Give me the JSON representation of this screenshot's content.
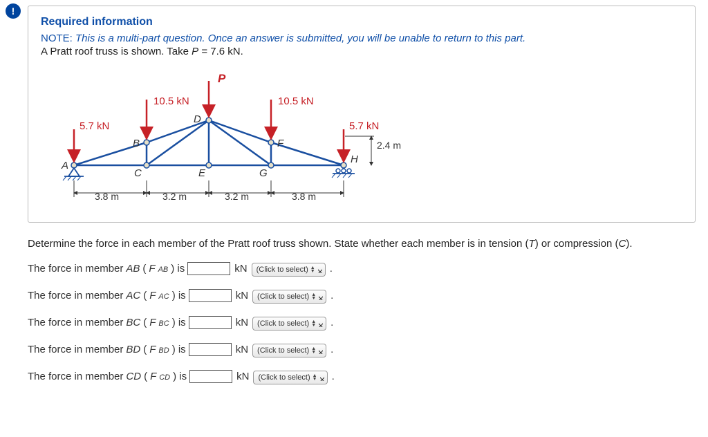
{
  "icon": "!",
  "header": "Required information",
  "note_prefix": "NOTE: ",
  "note_body": "This is a multi-part question. Once an answer is submitted, you will be unable to return to this part.",
  "given": "A Pratt roof truss is shown. Take ",
  "given_var": "P",
  "given_rest": " = 7.6 kN.",
  "diagram": {
    "P": "P",
    "load_top_left": "10.5 kN",
    "load_top_right": "10.5 kN",
    "load_left": "5.7 kN",
    "load_right": "5.7 kN",
    "A": "A",
    "B": "B",
    "C": "C",
    "D": "D",
    "E": "E",
    "F": "F",
    "G": "G",
    "H": "H",
    "h": "2.4 m",
    "d1": "3.8 m",
    "d2": "3.2 m",
    "d3": "3.2 m",
    "d4": "3.8 m"
  },
  "question": {
    "pre": "Determine the force in each member of the Pratt roof truss shown. State whether each member is in tension (",
    "t": "T",
    "mid": ") or compression (",
    "c": "C",
    "post": ")."
  },
  "rows": [
    {
      "pre": "The force in member ",
      "member": "AB",
      "fsym": "F",
      "sub": "AB",
      "after": ") is"
    },
    {
      "pre": "The force in member ",
      "member": "AC",
      "fsym": "F",
      "sub": "AC",
      "after": ") is"
    },
    {
      "pre": "The force in member ",
      "member": "BC",
      "fsym": "F",
      "sub": "BC",
      "after": ") is"
    },
    {
      "pre": "The force in member ",
      "member": "BD",
      "fsym": "F",
      "sub": "BD",
      "after": ") is"
    },
    {
      "pre": "The force in member ",
      "member": "CD",
      "fsym": "F",
      "sub": "CD",
      "after": ") is"
    }
  ],
  "unit": "kN",
  "select_label": "(Click to select)",
  "period": "."
}
